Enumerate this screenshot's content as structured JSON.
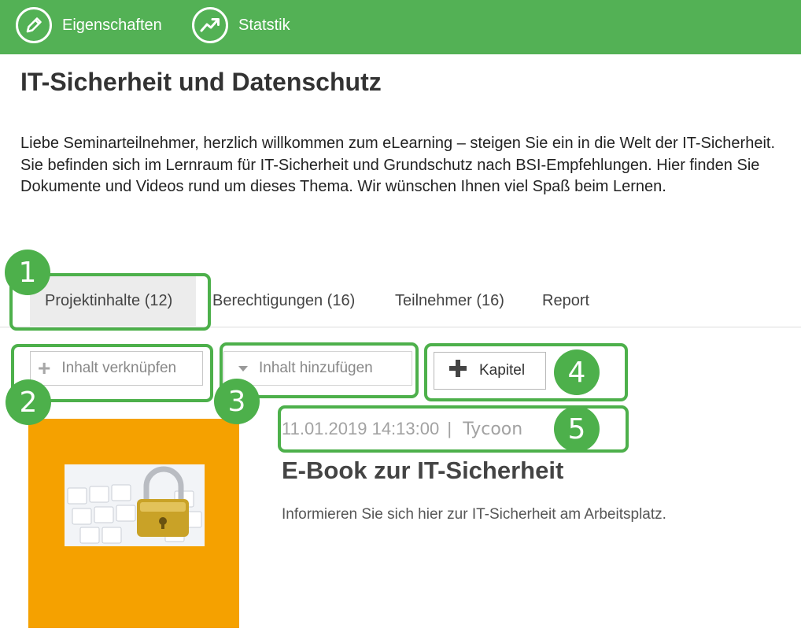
{
  "topbar": {
    "items": [
      {
        "label": "Eigenschaften",
        "icon": "pencil-icon"
      },
      {
        "label": "Statstik",
        "icon": "trend-up-icon"
      }
    ],
    "background": "#53b155"
  },
  "page": {
    "title": "IT-Sicherheit und Datenschutz",
    "intro": "Liebe Seminarteilnehmer, herzlich willkommen zum eLearning – steigen Sie ein in die Welt der IT-Sicherheit. Sie befinden sich im Lernraum für IT-Sicherheit und Grundschutz nach BSI-Empfehlungen. Hier finden Sie Dokumente und Videos rund um dieses Thema. Wir wünschen Ihnen viel Spaß beim Lernen."
  },
  "tabs": [
    {
      "label": "Projektinhalte (12)",
      "active": true
    },
    {
      "label": "Berechtigungen (16)",
      "active": false
    },
    {
      "label": "Teilnehmer (16)",
      "active": false
    },
    {
      "label": "Report",
      "active": false
    }
  ],
  "toolbar": {
    "link_content": "Inhalt verknüpfen",
    "add_content": "Inhalt hinzufügen",
    "chapter": "Kapitel"
  },
  "callouts": [
    "1",
    "2",
    "3",
    "4",
    "5"
  ],
  "item": {
    "date": "11.01.2019 14:13:00",
    "separator": "|",
    "author": "Tycoon",
    "title": "E-Book zur IT-Sicherheit",
    "description": "Informieren Sie sich hier zur IT-Sicherheit am Arbeitsplatz.",
    "thumbnail_color": "#f5a100"
  },
  "accent": "#4db04b"
}
